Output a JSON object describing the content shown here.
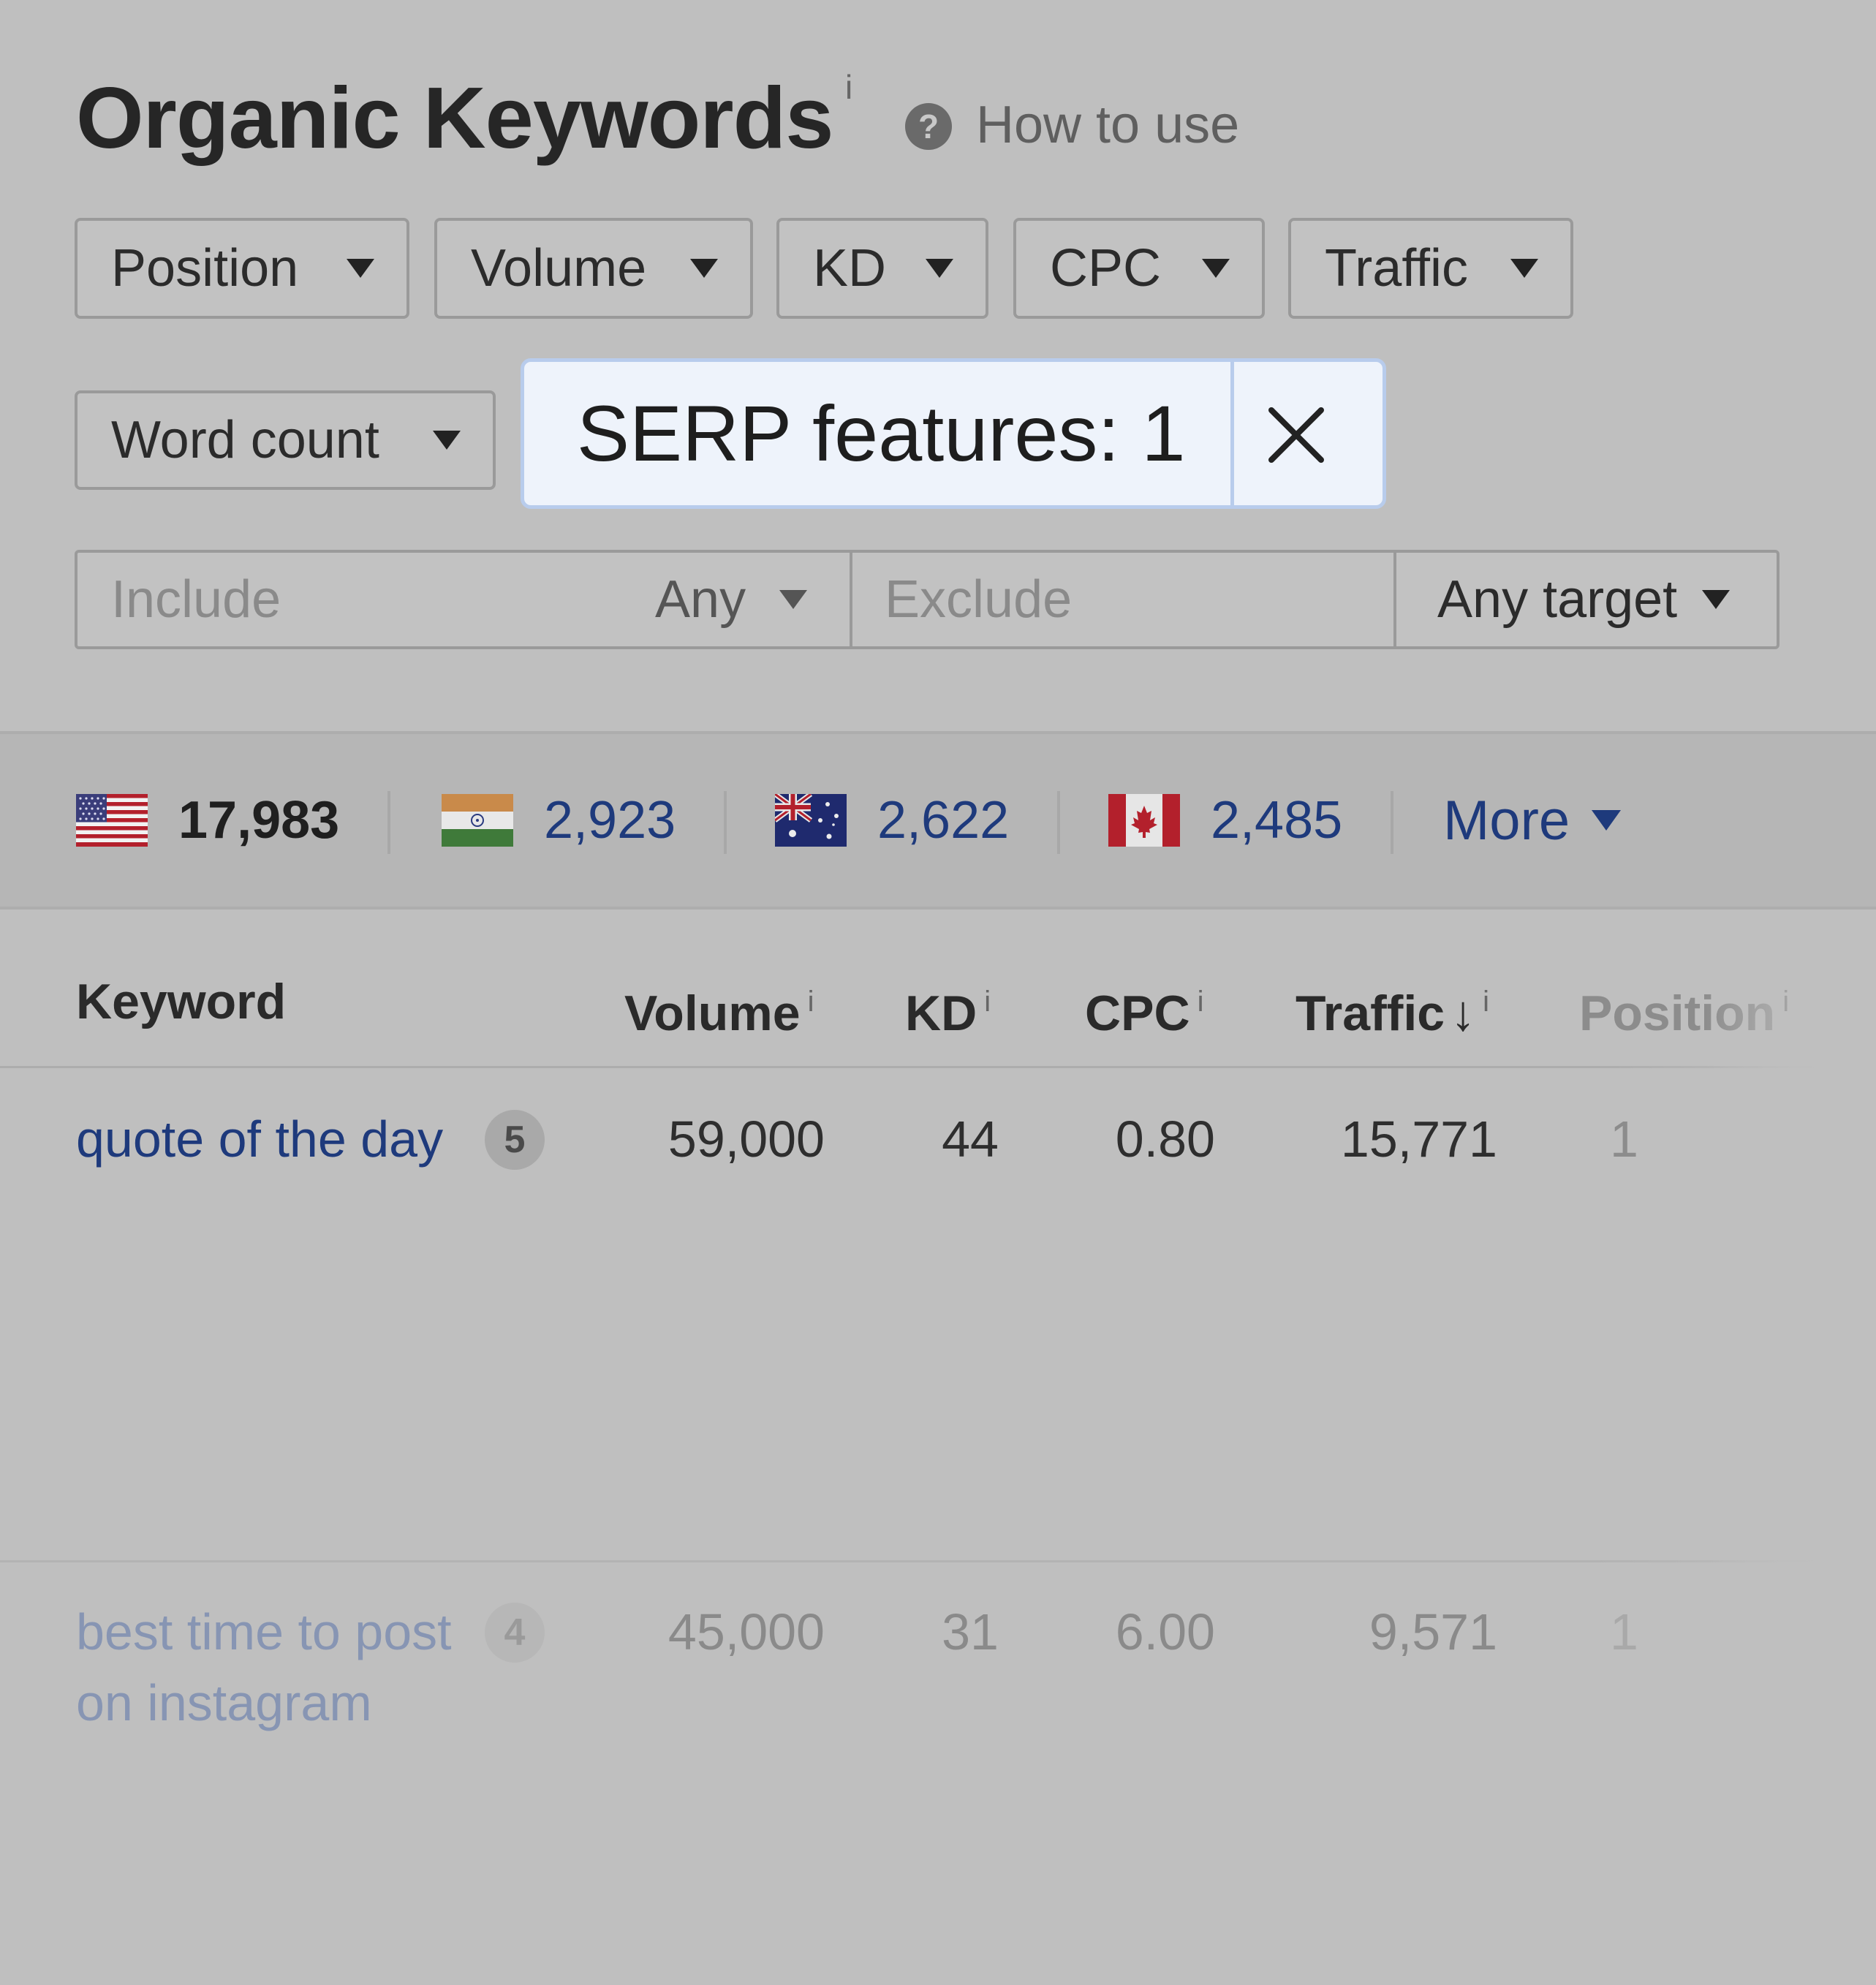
{
  "header": {
    "title": "Organic Keywords",
    "title_info": "i",
    "help_icon_glyph": "?",
    "how_to_use": "How to use"
  },
  "filters": {
    "position": "Position",
    "volume": "Volume",
    "kd": "KD",
    "cpc": "CPC",
    "traffic": "Traffic",
    "word_count": "Word count"
  },
  "serp_chip": {
    "label": "SERP features: 1",
    "close_icon": "close-icon"
  },
  "search": {
    "include_placeholder": "Include",
    "include_mode": "Any",
    "exclude_placeholder": "Exclude",
    "target": "Any target"
  },
  "countries": [
    {
      "flag": "us-flag",
      "value": "17,983"
    },
    {
      "flag": "india-flag",
      "value": "2,923"
    },
    {
      "flag": "australia-flag",
      "value": "2,622"
    },
    {
      "flag": "canada-flag",
      "value": "2,485"
    }
  ],
  "more_label": "More",
  "table": {
    "columns": {
      "keyword": "Keyword",
      "volume": "Volume",
      "kd": "KD",
      "cpc": "CPC",
      "traffic": "Traffic",
      "traffic_sort_arrow": "↓",
      "position": "Position",
      "info": "i"
    },
    "rows": [
      {
        "keyword": "quote of the day",
        "serp_count": "5",
        "volume": "59,000",
        "kd": "44",
        "cpc": "0.80",
        "traffic": "15,771",
        "position": "1"
      },
      {
        "keyword": "best time to post on instagram",
        "serp_count": "4",
        "volume": "45,000",
        "kd": "31",
        "cpc": "6.00",
        "traffic": "9,571",
        "position": "1"
      }
    ]
  },
  "colors": {
    "background": "#bfbfbf",
    "link": "#1e3a7c",
    "chip_bg": "#eef3fb",
    "chip_border": "#b8ccec"
  }
}
